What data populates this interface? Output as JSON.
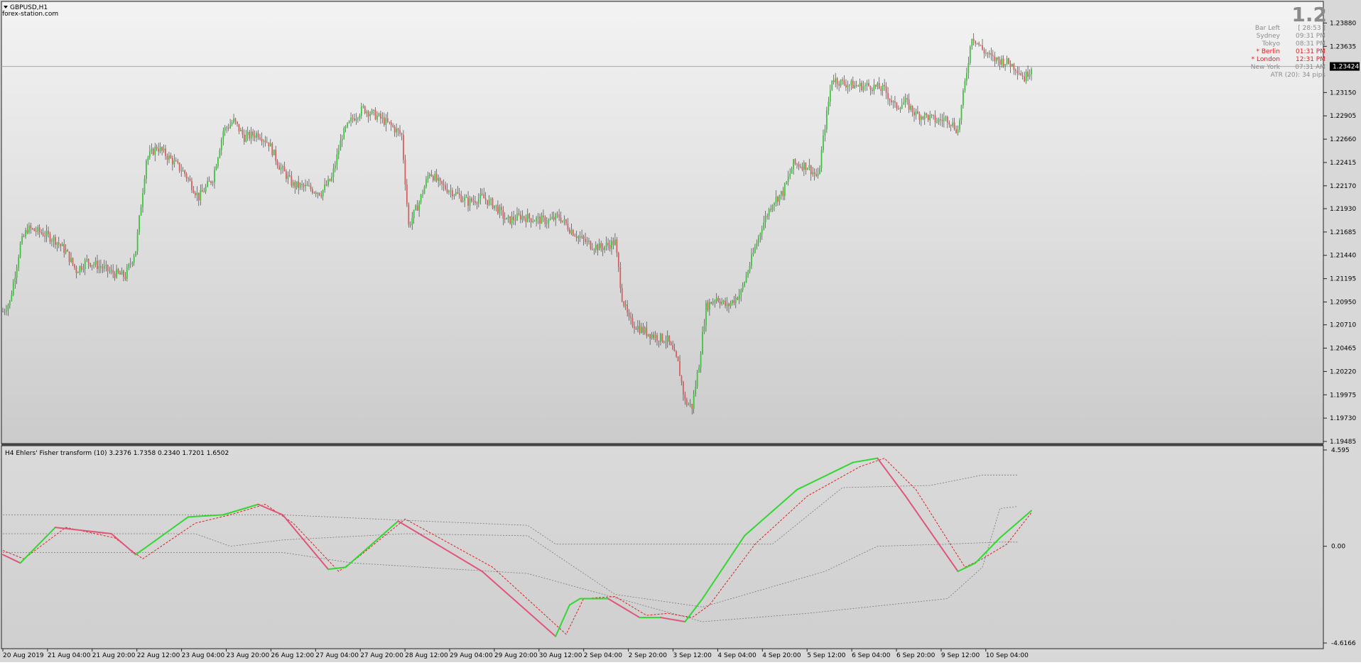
{
  "window": {
    "symbol": "GBPUSD,H1",
    "site": "forex-station.com",
    "big_price": "1.2"
  },
  "colors": {
    "background_top": "#f2f2f2",
    "background_bottom": "#c8c8c8",
    "bull_candle": "#3ec43e",
    "bear_candle": "#d95f5f",
    "fisher_up": "#33d633",
    "fisher_down": "#e0557a",
    "trigger": "#e02020",
    "levels": "#7a7a7a"
  },
  "info_panel": {
    "rows": [
      {
        "label": "Bar Left",
        "value": "[ 28:53 ]",
        "highlight": false
      },
      {
        "label": "Sydney",
        "value": "09:31 PM",
        "highlight": false
      },
      {
        "label": "Tokyo",
        "value": "08:31 PM",
        "highlight": false
      },
      {
        "label": "* Berlin",
        "value": "01:31 PM",
        "highlight": true
      },
      {
        "label": "* London",
        "value": "12:31 PM",
        "highlight": true
      },
      {
        "label": "New York",
        "value": "07:31 AM",
        "highlight": false
      }
    ],
    "atr": "ATR (20): 34 pips"
  },
  "price_axis": {
    "labels": [
      "1.23880",
      "1.23635",
      "1.23150",
      "1.22905",
      "1.22660",
      "1.22415",
      "1.22170",
      "1.21930",
      "1.21685",
      "1.21440",
      "1.21195",
      "1.20950",
      "1.20710",
      "1.20465",
      "1.20220",
      "1.19975",
      "1.19730",
      "1.19485"
    ],
    "current_price": "1.23424"
  },
  "indicator": {
    "title": "H4 Ehlers' Fisher transform (10) 3.2376 1.7358 0.2340 1.7201 1.6502",
    "axis_labels": [
      "4.595",
      "0.00",
      "-4.6166"
    ]
  },
  "time_axis": {
    "labels": [
      "20 Aug 2019",
      "21 Aug 04:00",
      "21 Aug 20:00",
      "22 Aug 12:00",
      "23 Aug 04:00",
      "23 Aug 20:00",
      "26 Aug 12:00",
      "27 Aug 04:00",
      "27 Aug 20:00",
      "28 Aug 12:00",
      "29 Aug 04:00",
      "29 Aug 20:00",
      "30 Aug 12:00",
      "2 Sep 04:00",
      "2 Sep 20:00",
      "3 Sep 12:00",
      "4 Sep 04:00",
      "4 Sep 20:00",
      "5 Sep 12:00",
      "6 Sep 04:00",
      "6 Sep 20:00",
      "9 Sep 12:00",
      "10 Sep 04:00"
    ]
  },
  "chart_data": [
    {
      "type": "candlestick",
      "title": "GBPUSD,H1",
      "ylim": [
        1.19485,
        1.2401
      ],
      "current_price": 1.23424,
      "y_ticks": [
        1.2388,
        1.23635,
        1.2315,
        1.22905,
        1.2266,
        1.22415,
        1.2217,
        1.2193,
        1.21685,
        1.2144,
        1.21195,
        1.2095,
        1.2071,
        1.20465,
        1.2022,
        1.19975,
        1.1973,
        1.19485
      ],
      "close_path": [
        [
          0,
          1.2085
        ],
        [
          4,
          1.2095
        ],
        [
          10,
          1.2155
        ],
        [
          14,
          1.2172
        ],
        [
          22,
          1.2168
        ],
        [
          30,
          1.216
        ],
        [
          36,
          1.2148
        ],
        [
          42,
          1.2128
        ],
        [
          48,
          1.2138
        ],
        [
          56,
          1.2132
        ],
        [
          62,
          1.2126
        ],
        [
          70,
          1.2122
        ],
        [
          76,
          1.215
        ],
        [
          82,
          1.2245
        ],
        [
          88,
          1.2258
        ],
        [
          96,
          1.2245
        ],
        [
          104,
          1.223
        ],
        [
          112,
          1.2205
        ],
        [
          120,
          1.2225
        ],
        [
          126,
          1.2275
        ],
        [
          132,
          1.2285
        ],
        [
          138,
          1.2268
        ],
        [
          146,
          1.2272
        ],
        [
          152,
          1.2262
        ],
        [
          158,
          1.2238
        ],
        [
          166,
          1.2218
        ],
        [
          174,
          1.2215
        ],
        [
          182,
          1.221
        ],
        [
          188,
          1.2225
        ],
        [
          194,
          1.227
        ],
        [
          200,
          1.2288
        ],
        [
          206,
          1.2298
        ],
        [
          214,
          1.229
        ],
        [
          222,
          1.228
        ],
        [
          228,
          1.227
        ],
        [
          232,
          1.2175
        ],
        [
          238,
          1.22
        ],
        [
          244,
          1.2232
        ],
        [
          250,
          1.2218
        ],
        [
          258,
          1.221
        ],
        [
          266,
          1.22
        ],
        [
          274,
          1.2205
        ],
        [
          282,
          1.2195
        ],
        [
          288,
          1.218
        ],
        [
          296,
          1.2185
        ],
        [
          304,
          1.2182
        ],
        [
          312,
          1.218
        ],
        [
          318,
          1.2185
        ],
        [
          324,
          1.2172
        ],
        [
          330,
          1.2162
        ],
        [
          336,
          1.2155
        ],
        [
          342,
          1.2152
        ],
        [
          350,
          1.2158
        ],
        [
          354,
          1.21
        ],
        [
          358,
          1.2075
        ],
        [
          366,
          1.2065
        ],
        [
          374,
          1.2058
        ],
        [
          380,
          1.2055
        ],
        [
          386,
          1.203
        ],
        [
          390,
          1.199
        ],
        [
          394,
          1.1985
        ],
        [
          398,
          1.203
        ],
        [
          402,
          1.209
        ],
        [
          408,
          1.21
        ],
        [
          414,
          1.209
        ],
        [
          422,
          1.2105
        ],
        [
          428,
          1.214
        ],
        [
          434,
          1.2175
        ],
        [
          440,
          1.22
        ],
        [
          446,
          1.221
        ],
        [
          452,
          1.224
        ],
        [
          460,
          1.2238
        ],
        [
          466,
          1.2225
        ],
        [
          470,
          1.228
        ],
        [
          474,
          1.233
        ],
        [
          480,
          1.2325
        ],
        [
          488,
          1.2322
        ],
        [
          496,
          1.2322
        ],
        [
          504,
          1.2318
        ],
        [
          510,
          1.23
        ],
        [
          516,
          1.2305
        ],
        [
          522,
          1.2292
        ],
        [
          528,
          1.229
        ],
        [
          534,
          1.2285
        ],
        [
          540,
          1.2288
        ],
        [
          546,
          1.2275
        ],
        [
          550,
          1.2325
        ],
        [
          554,
          1.2375
        ],
        [
          560,
          1.236
        ],
        [
          566,
          1.235
        ],
        [
          572,
          1.2348
        ],
        [
          576,
          1.2345
        ],
        [
          580,
          1.234
        ],
        [
          584,
          1.233
        ],
        [
          588,
          1.2342
        ]
      ]
    },
    {
      "type": "line",
      "title": "H4 Ehlers' Fisher transform (10) 3.2376 1.7358 0.2340 1.7201 1.6502",
      "ylim": [
        -4.6166,
        4.595
      ],
      "x_range": [
        0,
        588
      ],
      "series": [
        {
          "values": [
            [
              0,
              -0.4
            ],
            [
              10,
              -0.8
            ],
            [
              30,
              0.9
            ],
            [
              62,
              0.6
            ],
            [
              76,
              -0.4
            ],
            [
              106,
              1.4
            ],
            [
              126,
              1.5
            ],
            [
              146,
              2.0
            ],
            [
              160,
              1.5
            ],
            [
              186,
              -1.1
            ],
            [
              196,
              -1.0
            ],
            [
              226,
              1.2
            ],
            [
              274,
              -1.2
            ],
            [
              316,
              -4.3
            ],
            [
              324,
              -2.8
            ],
            [
              330,
              -2.5
            ],
            [
              346,
              -2.5
            ],
            [
              364,
              -3.4
            ],
            [
              376,
              -3.4
            ],
            [
              390,
              -3.6
            ],
            [
              400,
              -2.5
            ],
            [
              424,
              0.5
            ],
            [
              454,
              2.7
            ],
            [
              486,
              4.0
            ],
            [
              500,
              4.2
            ],
            [
              516,
              2.4
            ],
            [
              546,
              -1.2
            ],
            [
              556,
              -0.8
            ],
            [
              570,
              0.4
            ],
            [
              588,
              1.7
            ]
          ]
        },
        {
          "values": [
            [
              0,
              -0.2
            ],
            [
              12,
              -0.6
            ],
            [
              36,
              0.9
            ],
            [
              64,
              0.4
            ],
            [
              80,
              -0.6
            ],
            [
              110,
              1.1
            ],
            [
              130,
              1.5
            ],
            [
              150,
              2.0
            ],
            [
              166,
              1.1
            ],
            [
              192,
              -1.2
            ],
            [
              202,
              -0.6
            ],
            [
              230,
              1.3
            ],
            [
              280,
              -1.0
            ],
            [
              322,
              -4.2
            ],
            [
              332,
              -2.5
            ],
            [
              350,
              -2.4
            ],
            [
              368,
              -3.3
            ],
            [
              380,
              -3.2
            ],
            [
              394,
              -3.4
            ],
            [
              404,
              -2.8
            ],
            [
              430,
              0.1
            ],
            [
              460,
              2.4
            ],
            [
              490,
              3.8
            ],
            [
              504,
              4.2
            ],
            [
              522,
              2.7
            ],
            [
              550,
              -1.0
            ],
            [
              560,
              -0.6
            ],
            [
              574,
              0.1
            ],
            [
              588,
              1.6
            ]
          ]
        }
      ]
    }
  ]
}
